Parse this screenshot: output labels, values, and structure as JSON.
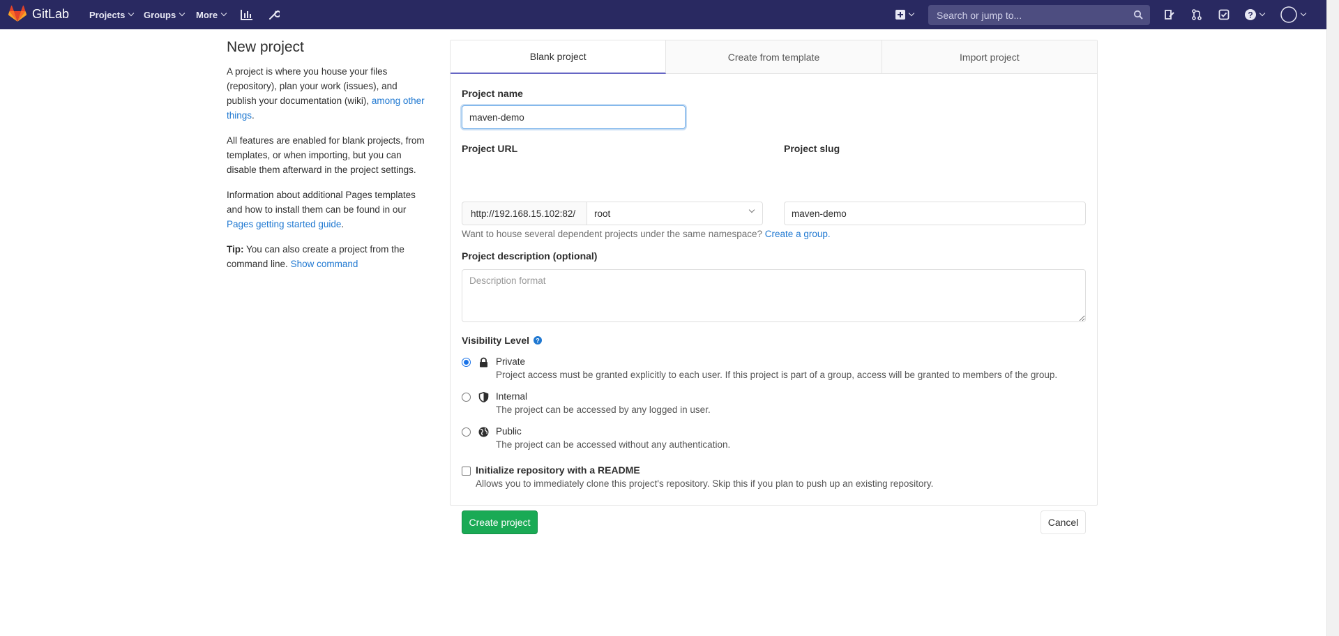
{
  "navbar": {
    "brand": "GitLab",
    "projects": "Projects",
    "groups": "Groups",
    "more": "More",
    "search_placeholder": "Search or jump to...",
    "icons": [
      "activity-chart-icon",
      "admin-wrench-icon",
      "new-plus-icon",
      "search-icon",
      "todo-issues-icon",
      "merge-requests-icon",
      "todos-check-icon",
      "help-icon",
      "user-avatar"
    ],
    "background": "#292961"
  },
  "sidebar": {
    "title": "New project",
    "p1_text": "A project is where you house your files (repository), plan your work (issues), and publish your documentation (wiki),",
    "p1_link": "among other things",
    "p1_end": ".",
    "p2": "All features are enabled for blank projects, from templates, or when importing, but you can disable them afterward in the project settings.",
    "p3_text": "Information about additional Pages templates and how to install them can be found in our",
    "p3_link": "Pages getting started guide",
    "p3_end": ".",
    "tip_label": "Tip:",
    "tip_text": "You can also create a project from the command line.",
    "tip_link": "Show command"
  },
  "tabs": [
    "Blank project",
    "Create from template",
    "Import project"
  ],
  "form": {
    "project_name_label": "Project name",
    "project_name_value": "maven-demo",
    "project_url_label": "Project URL",
    "url_prefix": "http://192.168.15.102:82/",
    "namespace": "root",
    "project_slug_label": "Project slug",
    "project_slug_value": "maven-demo",
    "namespace_help": "Want to house several dependent projects under the same namespace?",
    "namespace_help_link": "Create a group.",
    "description_label": "Project description (optional)",
    "description_placeholder": "Description format",
    "visibility_label": "Visibility Level",
    "visibility": [
      {
        "title": "Private",
        "desc": "Project access must be granted explicitly to each user. If this project is part of a group, access will be granted to members of the group.",
        "checked": true,
        "icon": "lock-icon"
      },
      {
        "title": "Internal",
        "desc": "The project can be accessed by any logged in user.",
        "checked": false,
        "icon": "shield-icon"
      },
      {
        "title": "Public",
        "desc": "The project can be accessed without any authentication.",
        "checked": false,
        "icon": "globe-icon"
      }
    ],
    "readme_label": "Initialize repository with a README",
    "readme_desc": "Allows you to immediately clone this project's repository. Skip this if you plan to push up an existing repository.",
    "create_button": "Create project",
    "cancel_button": "Cancel"
  },
  "colors": {
    "accent_link": "#1f78d1",
    "create_button": "#1aaa55",
    "active_tab_border": "#6666c4"
  }
}
